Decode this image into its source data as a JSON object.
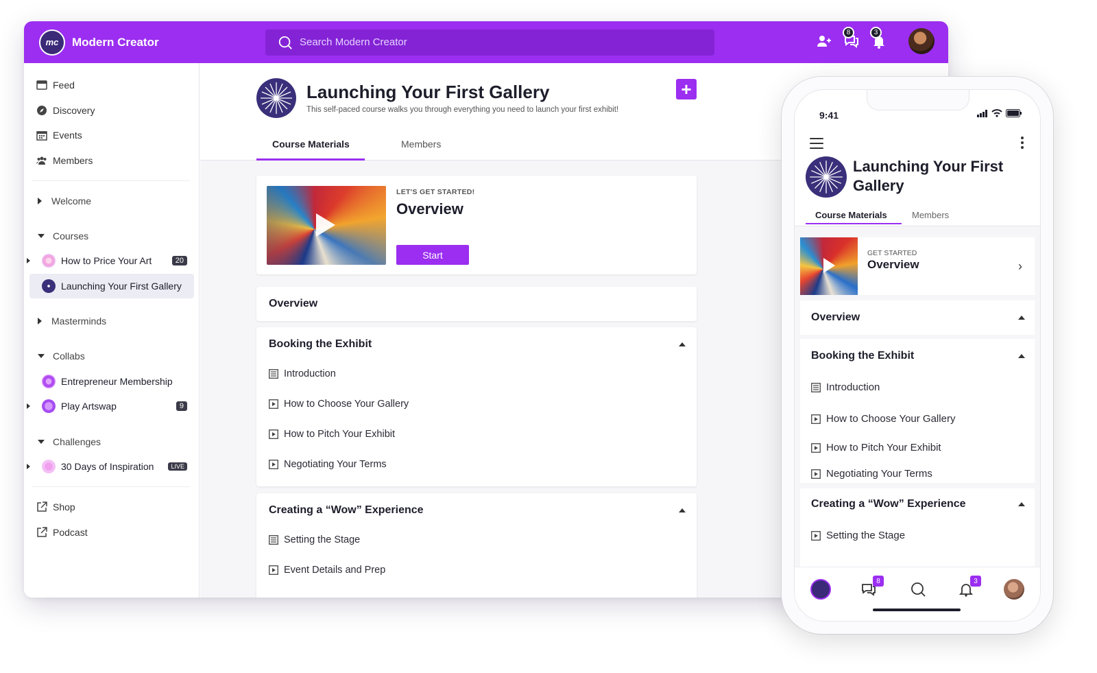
{
  "app": {
    "name": "Modern Creator",
    "logo_text": "mc",
    "accent": "#9b2ef0"
  },
  "search": {
    "placeholder": "Search Modern Creator"
  },
  "topbar": {
    "chat_badge": "8",
    "bell_badge": "3"
  },
  "sidebar": {
    "nav": [
      {
        "label": "Feed",
        "icon": "feed-icon"
      },
      {
        "label": "Discovery",
        "icon": "compass-icon"
      },
      {
        "label": "Events",
        "icon": "calendar-icon"
      },
      {
        "label": "Members",
        "icon": "people-icon"
      }
    ],
    "welcome": "Welcome",
    "courses": {
      "label": "Courses",
      "items": [
        {
          "label": "How to Price Your Art",
          "count": "20"
        },
        {
          "label": "Launching Your First Gallery"
        }
      ]
    },
    "masterminds": "Masterminds",
    "collabs": {
      "label": "Collabs",
      "items": [
        {
          "label": "Entrepreneur Membership"
        },
        {
          "label": "Play Artswap",
          "count": "9"
        }
      ]
    },
    "challenges": {
      "label": "Challenges",
      "items": [
        {
          "label": "30 Days of Inspiration",
          "badge": "LIVE"
        }
      ]
    },
    "links": [
      {
        "label": "Shop",
        "icon": "external-link-icon"
      },
      {
        "label": "Podcast",
        "icon": "external-link-icon"
      }
    ]
  },
  "course": {
    "title": "Launching Your First Gallery",
    "subtitle": "This self-paced course walks you through everything you need to launch your first exhibit!",
    "tabs": [
      "Course Materials",
      "Members"
    ],
    "hero": {
      "eyebrow": "LET'S GET STARTED!",
      "title": "Overview",
      "button": "Start"
    },
    "overview_section": "Overview",
    "sections": [
      {
        "title": "Booking the Exhibit",
        "lessons": [
          {
            "label": "Introduction",
            "type": "text"
          },
          {
            "label": "How to Choose Your Gallery",
            "type": "video"
          },
          {
            "label": "How to Pitch Your Exhibit",
            "type": "video"
          },
          {
            "label": "Negotiating Your Terms",
            "type": "video"
          }
        ]
      },
      {
        "title": "Creating a “Wow” Experience",
        "lessons": [
          {
            "label": "Setting the Stage",
            "type": "text"
          },
          {
            "label": "Event Details and Prep",
            "type": "video"
          }
        ]
      }
    ]
  },
  "phone": {
    "time": "9:41",
    "title": "Launching Your First Gallery",
    "tabs": [
      "Course Materials",
      "Members"
    ],
    "hero": {
      "eyebrow": "GET STARTED",
      "title": "Overview"
    },
    "overview_section": "Overview",
    "sections": [
      {
        "title": "Booking the Exhibit",
        "lessons": [
          "Introduction",
          "How to Choose Your Gallery",
          "How to Pitch Your Exhibit",
          "Negotiating Your Terms"
        ]
      },
      {
        "title": "Creating a “Wow” Experience",
        "lessons": [
          "Setting the Stage"
        ]
      }
    ],
    "nav": {
      "chat_badge": "8",
      "bell_badge": "3"
    }
  }
}
